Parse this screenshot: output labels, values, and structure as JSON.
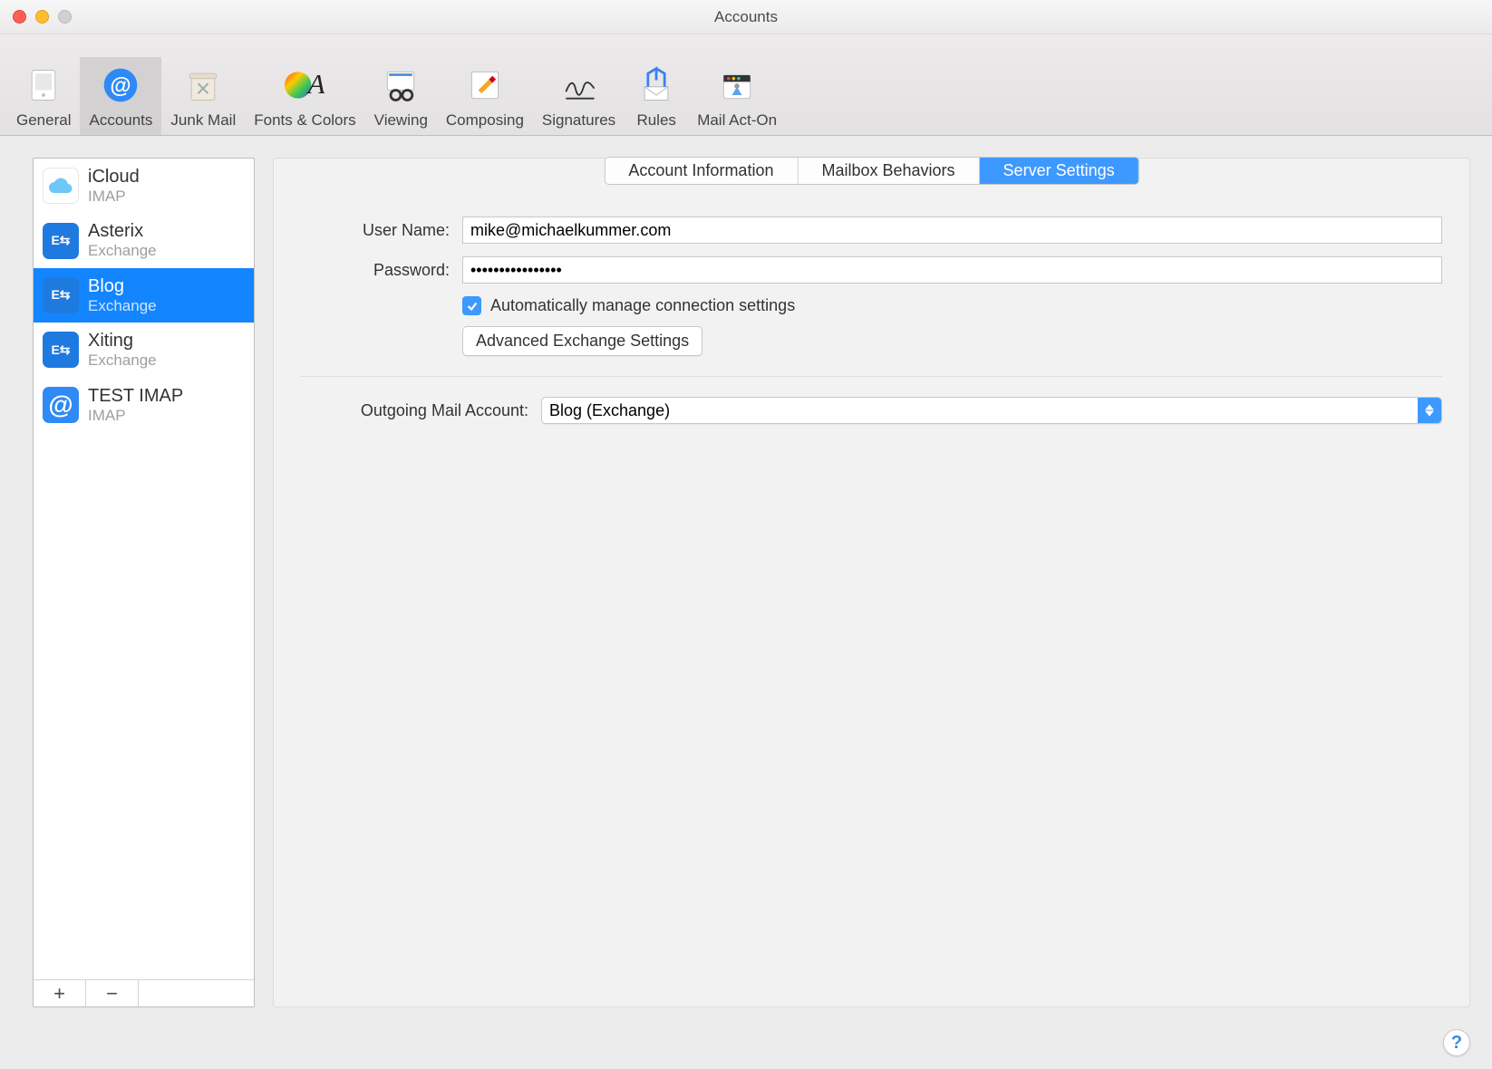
{
  "window": {
    "title": "Accounts"
  },
  "toolbar": {
    "items": [
      {
        "label": "General"
      },
      {
        "label": "Accounts"
      },
      {
        "label": "Junk Mail"
      },
      {
        "label": "Fonts & Colors"
      },
      {
        "label": "Viewing"
      },
      {
        "label": "Composing"
      },
      {
        "label": "Signatures"
      },
      {
        "label": "Rules"
      },
      {
        "label": "Mail Act-On"
      }
    ],
    "selected_index": 1
  },
  "sidebar": {
    "accounts": [
      {
        "name": "iCloud",
        "type": "IMAP",
        "icon": "cloud"
      },
      {
        "name": "Asterix",
        "type": "Exchange",
        "icon": "exchange"
      },
      {
        "name": "Blog",
        "type": "Exchange",
        "icon": "exchange"
      },
      {
        "name": "Xiting",
        "type": "Exchange",
        "icon": "exchange"
      },
      {
        "name": "TEST IMAP",
        "type": "IMAP",
        "icon": "at"
      }
    ],
    "selected_index": 2,
    "add_label": "+",
    "remove_label": "−"
  },
  "tabs": {
    "items": [
      "Account Information",
      "Mailbox Behaviors",
      "Server Settings"
    ],
    "selected_index": 2
  },
  "form": {
    "username_label": "User Name:",
    "username_value": "mike@michaelkummer.com",
    "password_label": "Password:",
    "password_value": "••••••••••••••••",
    "auto_manage_checked": true,
    "auto_manage_label": "Automatically manage connection settings",
    "advanced_button": "Advanced Exchange Settings",
    "outgoing_label": "Outgoing Mail Account:",
    "outgoing_value": "Blog (Exchange)"
  },
  "help_label": "?"
}
